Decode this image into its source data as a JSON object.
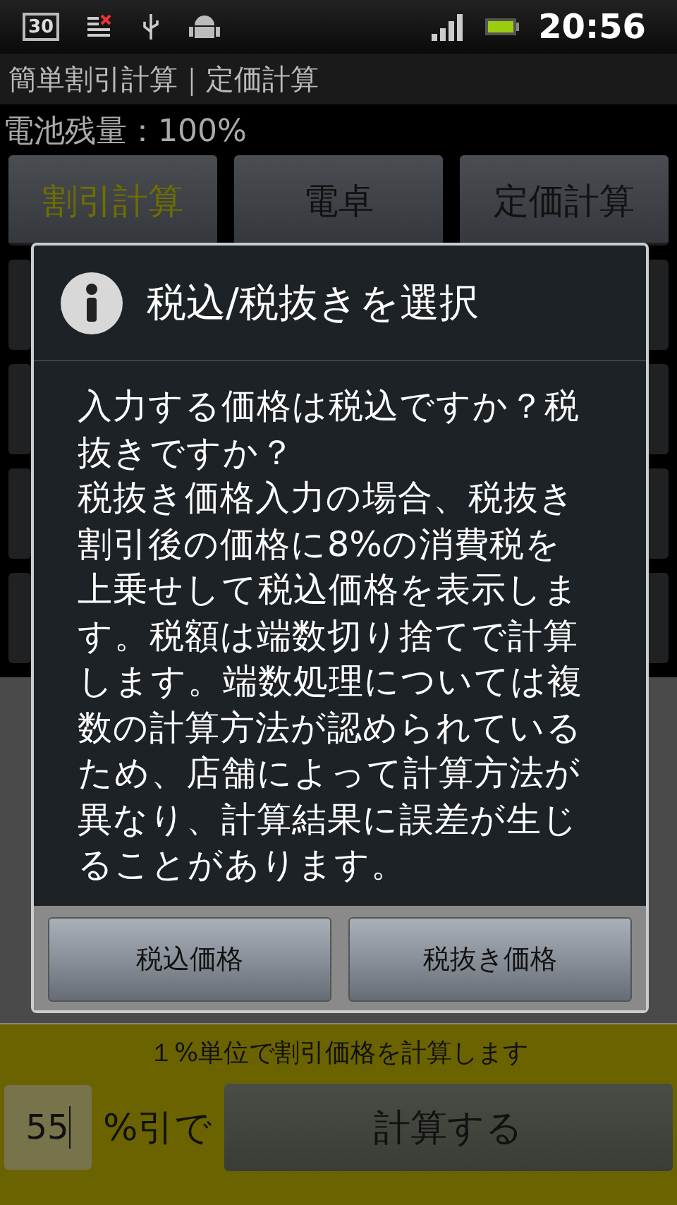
{
  "status_bar": {
    "calendar_day": "30",
    "time": "20:56"
  },
  "app_title": "簡単割引計算｜定価計算",
  "battery_label": "電池残量：100%",
  "tabs": [
    {
      "label": "割引計算",
      "selected": true
    },
    {
      "label": "電卓",
      "selected": false
    },
    {
      "label": "定価計算",
      "selected": false
    }
  ],
  "dialog": {
    "title": "税込/税抜きを選択",
    "paragraphs": [
      "入力する価格は税込ですか？税抜きですか？",
      "税抜き価格入力の場合、税抜き割引後の価格に8%の消費税を上乗せして税込価格を表示します。税額は端数切り捨てで計算します。端数処理については複数の計算方法が認められているため、店舗によって計算方法が異なり、計算結果に誤差が生じることがあります。"
    ],
    "buttons": [
      "税込価格",
      "税抜き価格"
    ]
  },
  "footer": {
    "hint": "１%単位で割引価格を計算します",
    "discount_value": "55",
    "discount_suffix": "%引で",
    "calculate_button": "計算する"
  }
}
